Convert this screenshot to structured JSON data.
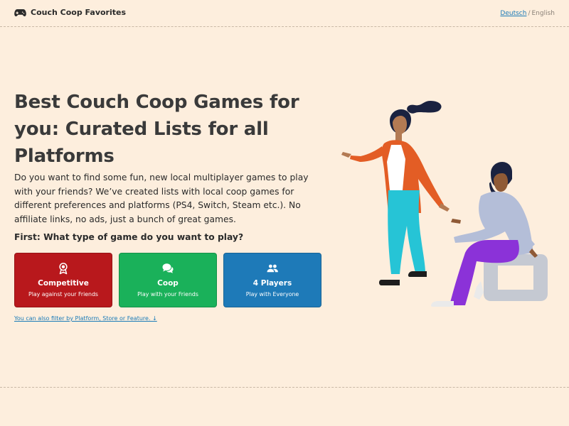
{
  "header": {
    "brand": "Couch Coop Favorites",
    "brand_icon": "gamepad-icon",
    "lang_active": "Deutsch",
    "lang_separator": "/",
    "lang_current": "English"
  },
  "hero": {
    "title": "Best Couch Coop Games for you: Curated Lists for all Platforms",
    "intro": "Do you want to find some fun, new local multiplayer games to play with your friends? We’ve created lists with local coop games for different preferences and platforms (PS4, Switch, Steam etc.). No affiliate links, no ads, just a bunch of great games.",
    "question": "First: What type of game do you want to play?"
  },
  "cards": [
    {
      "title": "Competitive",
      "subtitle": "Play against your Friends",
      "icon": "medal-icon",
      "color": "#b8181c"
    },
    {
      "title": "Coop",
      "subtitle": "Play with your Friends",
      "icon": "chat-bubbles-icon",
      "color": "#1ab15a"
    },
    {
      "title": "4 Players",
      "subtitle": "Play with Everyone",
      "icon": "people-icon",
      "color": "#1e7ab8"
    }
  ],
  "filter_link": "You can also filter by Platform, Store or Feature. ↓",
  "colors": {
    "background": "#fdeedd",
    "link": "#1a7bb8"
  }
}
